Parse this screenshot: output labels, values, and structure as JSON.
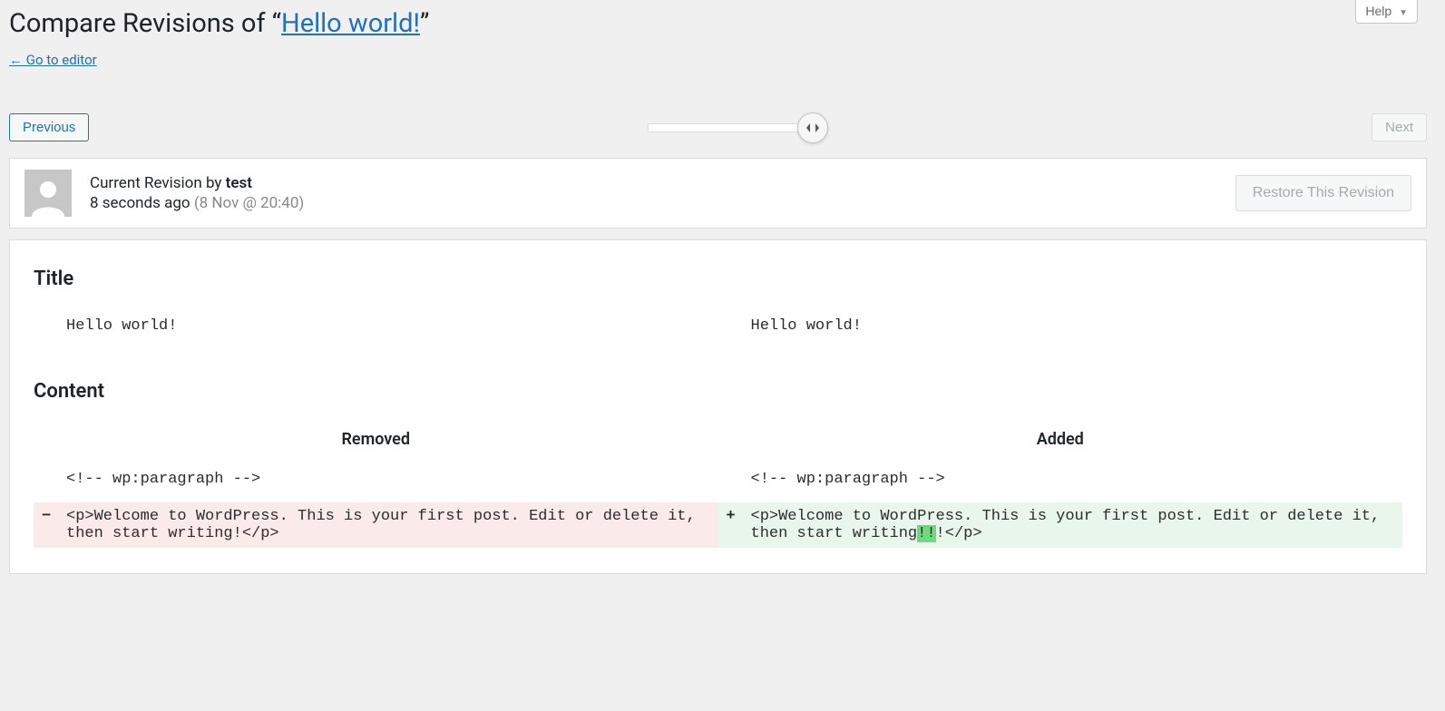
{
  "help_label": "Help",
  "page_title_prefix": "Compare Revisions of “",
  "page_title_link": "Hello world!",
  "page_title_suffix": "”",
  "back_link": "← Go to editor",
  "nav": {
    "prev": "Previous",
    "next": "Next"
  },
  "meta": {
    "revision_by_prefix": "Current Revision by ",
    "author": "test",
    "time_ago": "8 seconds ago",
    "timestamp_paren": "(8 Nov @ 20:40)",
    "restore_label": "Restore This Revision"
  },
  "diff": {
    "sections": {
      "title": {
        "label": "Title",
        "left": "Hello world!",
        "right": "Hello world!"
      },
      "content": {
        "label": "Content",
        "removed_label": "Removed",
        "added_label": "Added",
        "context_left": "<!-- wp:paragraph -->",
        "context_right": "<!-- wp:paragraph -->",
        "removed_line": "<p>Welcome to WordPress. This is your first post. Edit or delete it, then start writing!</p>",
        "added_prefix": "<p>Welcome to WordPress. This is your first post. Edit or delete it, then start writing",
        "added_insert": "!!",
        "added_suffix": "!</p>"
      }
    }
  }
}
